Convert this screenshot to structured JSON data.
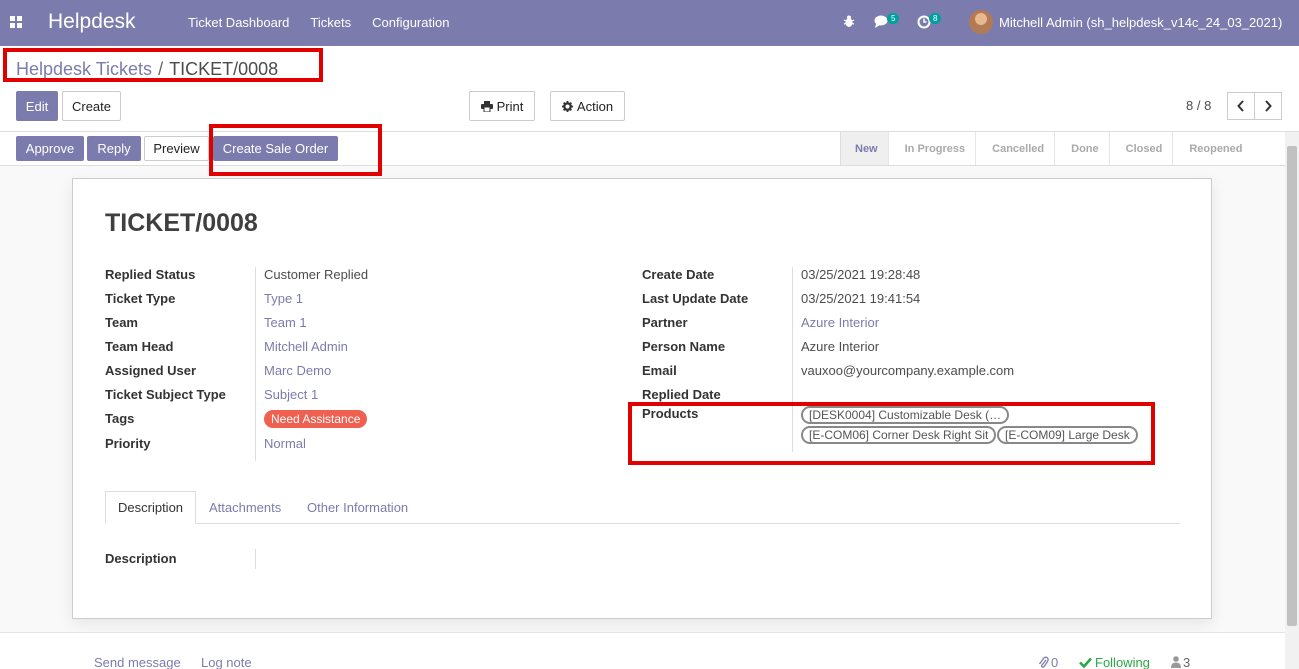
{
  "navbar": {
    "brand": "Helpdesk",
    "menu": [
      "Ticket Dashboard",
      "Tickets",
      "Configuration"
    ],
    "messages_count": "5",
    "activities_count": "8",
    "user": "Mitchell Admin (sh_helpdesk_v14c_24_03_2021)"
  },
  "breadcrumb": {
    "parent": "Helpdesk Tickets",
    "separator": "/",
    "current": "TICKET/0008"
  },
  "toolbar": {
    "edit": "Edit",
    "create": "Create",
    "print": "Print",
    "action": "Action",
    "pager": "8 / 8"
  },
  "header_buttons": {
    "approve": "Approve",
    "reply": "Reply",
    "preview": "Preview",
    "create_sale_order": "Create Sale Order"
  },
  "stages": [
    "New",
    "In Progress",
    "Cancelled",
    "Done",
    "Closed",
    "Reopened"
  ],
  "active_stage": "New",
  "ticket": {
    "name": "TICKET/0008",
    "left_fields": [
      {
        "label": "Replied Status",
        "value": "Customer Replied"
      },
      {
        "label": "Ticket Type",
        "value": "Type 1"
      },
      {
        "label": "Team",
        "value": "Team 1"
      },
      {
        "label": "Team Head",
        "value": "Mitchell Admin"
      },
      {
        "label": "Assigned User",
        "value": "Marc Demo"
      },
      {
        "label": "Ticket Subject Type",
        "value": "Subject 1"
      },
      {
        "label": "Tags",
        "value": "Need Assistance"
      },
      {
        "label": "Priority",
        "value": "Normal"
      }
    ],
    "right_fields": [
      {
        "label": "Create Date",
        "value": "03/25/2021 19:28:48"
      },
      {
        "label": "Last Update Date",
        "value": "03/25/2021 19:41:54"
      },
      {
        "label": "Partner",
        "value": "Azure Interior"
      },
      {
        "label": "Person Name",
        "value": "Azure Interior"
      },
      {
        "label": "Email",
        "value": "vauxoo@yourcompany.example.com"
      },
      {
        "label": "Replied Date",
        "value": ""
      }
    ],
    "products_label": "Products",
    "products": [
      "[DESK0004] Customizable Desk (…",
      "[E-COM06] Corner Desk Right Sit",
      "[E-COM09] Large Desk"
    ]
  },
  "tabs": [
    "Description",
    "Attachments",
    "Other Information"
  ],
  "description_label": "Description",
  "chatter": {
    "send_message": "Send message",
    "log_note": "Log note",
    "attachments": "0",
    "following": "Following",
    "followers": "3"
  }
}
